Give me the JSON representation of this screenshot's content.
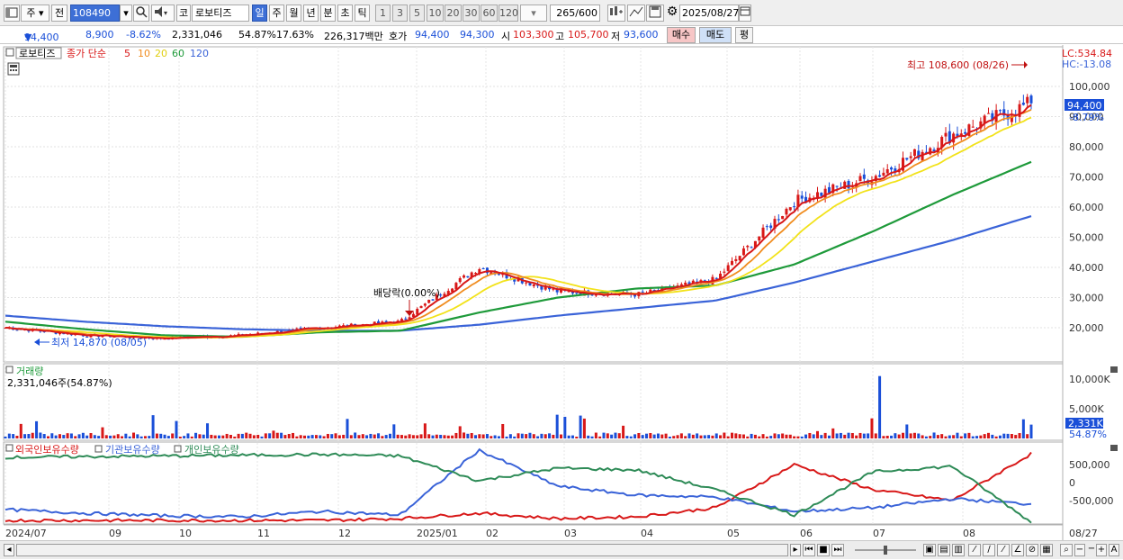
{
  "toolbar": {
    "market": "주",
    "prev_label": "전",
    "code": "108490",
    "market_prefix": "코",
    "stock_name": "로보티즈",
    "periods": [
      "일",
      "주",
      "월",
      "년",
      "분",
      "초",
      "틱"
    ],
    "active_period": "일",
    "intervals": [
      "1",
      "3",
      "5",
      "10",
      "20",
      "30",
      "60",
      "120"
    ],
    "count": "265",
    "count_max": "/600",
    "date": "2025/08/27"
  },
  "info": {
    "price": "94,400",
    "change": "8,900",
    "change_pct": "-8.62%",
    "volume": "2,331,046",
    "volume_ratio": "54.87%",
    "turnover": "17.63%",
    "amount": "226,317백만",
    "quote_label": "호가",
    "ask": "94,400",
    "bid": "94,300",
    "open_label": "시",
    "open": "103,300",
    "high_label": "고",
    "high": "105,700",
    "low_label": "저",
    "low": "93,600",
    "buy_label": "매수",
    "sell_label": "매도",
    "eval_label": "평"
  },
  "price_panel": {
    "stock_name": "로보티즈",
    "ma_title": "종가 단순",
    "ma_periods": [
      "5",
      "10",
      "20",
      "60",
      "120"
    ],
    "lc_label": "LC:534.84",
    "hc_label": "HC:-13.08",
    "current_price": "94,400",
    "current_pct": "-8.79%",
    "high_annotation": "최고 108,600 (08/26)",
    "low_annotation": "최저 14,870 (08/05)",
    "dividend_annotation": "배당락(0.00%)",
    "y_labels": [
      "100,000",
      "90,000",
      "80,000",
      "70,000",
      "60,000",
      "50,000",
      "40,000",
      "30,000",
      "20,000"
    ]
  },
  "volume_panel": {
    "title": "거래량",
    "value": "2,331,046주(54.87%)",
    "y_labels": [
      "10,000K",
      "5,000K"
    ],
    "current": "2,331K",
    "current_pct": "54.87%"
  },
  "holdings_panel": {
    "series_names": [
      "외국인보유수량",
      "기관보유수량",
      "개인보유수량"
    ],
    "y_labels": [
      "500,000",
      "0",
      "-500,000"
    ]
  },
  "x_axis": {
    "labels": [
      "2024/07",
      "09",
      "10",
      "11",
      "12",
      "2025/01",
      "02",
      "03",
      "04",
      "05",
      "06",
      "07",
      "08"
    ],
    "right_label": "08/27"
  },
  "colors": {
    "up": "#d81818",
    "down": "#1a4fd8",
    "ma5": "#d81818",
    "ma10": "#f08c1e",
    "ma20": "#f2e21a",
    "ma60": "#1e9a3a",
    "ma120": "#3a63d8",
    "foreign": "#d81818",
    "institution": "#3a63d8",
    "individual": "#2e8b57"
  },
  "chart_data": {
    "type": "line",
    "title": "로보티즈",
    "ylim": [
      15000,
      110000
    ],
    "x": [
      "2024/07",
      "09",
      "10",
      "11",
      "12",
      "2025/01",
      "02",
      "03",
      "04",
      "05",
      "06",
      "07",
      "08",
      "08/27"
    ],
    "series": [
      {
        "name": "종가",
        "values": [
          20000,
          17500,
          16500,
          17500,
          20000,
          22000,
          40000,
          32000,
          31000,
          36000,
          62000,
          70000,
          84000,
          94400
        ]
      },
      {
        "name": "60",
        "values": [
          22000,
          19500,
          17500,
          17000,
          18500,
          19000,
          25000,
          30000,
          33000,
          34000,
          41000,
          52000,
          64000,
          75000
        ]
      },
      {
        "name": "120",
        "values": [
          24000,
          22000,
          20500,
          19500,
          19000,
          19000,
          21000,
          24000,
          26500,
          29000,
          35000,
          42000,
          49000,
          57000
        ]
      }
    ],
    "volume_max": 10000000,
    "volume_last": 2331046
  }
}
